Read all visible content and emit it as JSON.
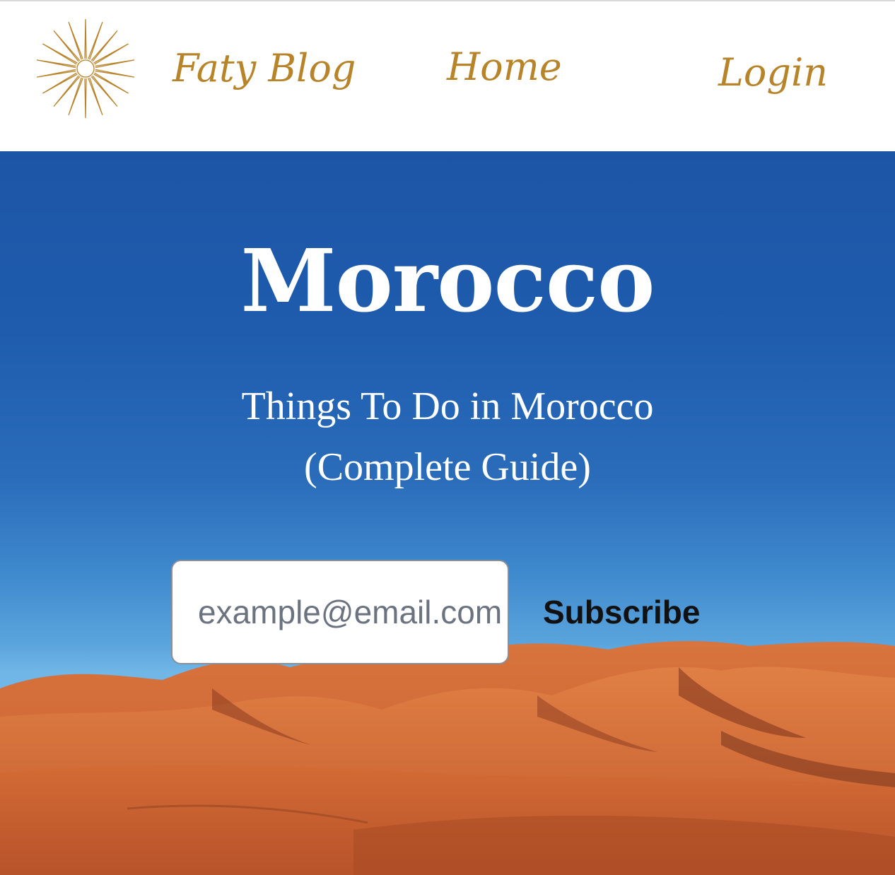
{
  "header": {
    "logo_icon": "sun-star-icon",
    "brand": "Faty Blog",
    "nav": {
      "home": "Home",
      "login": "Login"
    }
  },
  "hero": {
    "title": "Morocco",
    "subtitle_line1": "Things To Do in Morocco",
    "subtitle_line2": "(Complete Guide)",
    "background": "desert-dunes-image",
    "subscribe": {
      "placeholder": "example@email.com",
      "button": "Subscribe"
    }
  },
  "colors": {
    "accent": "#b8842a",
    "sky_top": "#1d55a6",
    "sky_bottom": "#70b6e6",
    "dune": "#c9582a",
    "text_light": "#ffffff"
  }
}
